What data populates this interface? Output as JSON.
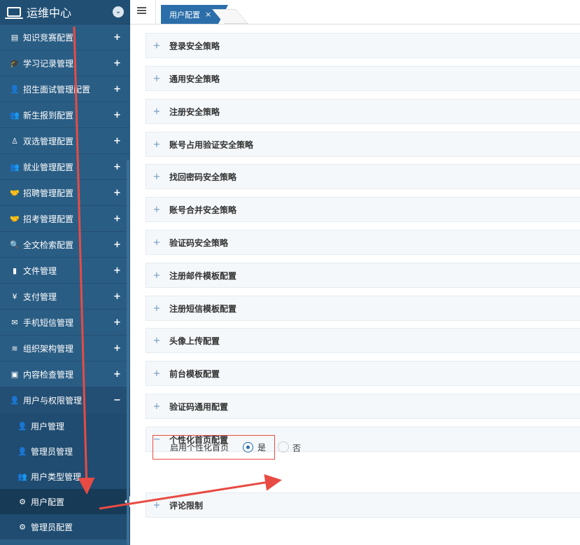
{
  "app": {
    "title": "运维中心"
  },
  "sidebar": {
    "items": [
      {
        "label": "知识竞赛配置",
        "icon": "document-icon",
        "glyph": "▤"
      },
      {
        "label": "学习记录管理",
        "icon": "graduation-cap-icon",
        "glyph": "🎓"
      },
      {
        "label": "招生面试管理配置",
        "icon": "user-plus-icon",
        "glyph": "👤"
      },
      {
        "label": "新生报到配置",
        "icon": "users-icon",
        "glyph": "👥"
      },
      {
        "label": "双选管理配置",
        "icon": "user-outline-icon",
        "glyph": "♙"
      },
      {
        "label": "就业管理配置",
        "icon": "user-group-icon",
        "glyph": "👥"
      },
      {
        "label": "招聘管理配置",
        "icon": "handshake-icon",
        "glyph": "🤝"
      },
      {
        "label": "招考管理配置",
        "icon": "handshake-icon",
        "glyph": "🤝"
      },
      {
        "label": "全文检索配置",
        "icon": "search-icon",
        "glyph": "🔍"
      },
      {
        "label": "文件管理",
        "icon": "file-icon",
        "glyph": "▮"
      },
      {
        "label": "支付管理",
        "icon": "yen-icon",
        "glyph": "¥"
      },
      {
        "label": "手机短信管理",
        "icon": "envelope-icon",
        "glyph": "✉"
      },
      {
        "label": "组织架构管理",
        "icon": "layers-icon",
        "glyph": "≋"
      },
      {
        "label": "内容检查管理",
        "icon": "image-icon",
        "glyph": "▣"
      }
    ],
    "open_group": {
      "label": "用户与权限管理",
      "icon": "user-icon",
      "glyph": "👤",
      "toggle": "−"
    },
    "sub_items": [
      {
        "label": "用户管理",
        "icon": "user-icon",
        "glyph": "👤"
      },
      {
        "label": "管理员管理",
        "icon": "user-icon",
        "glyph": "👤"
      },
      {
        "label": "用户类型管理",
        "icon": "users-icon",
        "glyph": "👥"
      },
      {
        "label": "用户配置",
        "icon": "gear-icon",
        "glyph": "⚙"
      },
      {
        "label": "管理员配置",
        "icon": "gear-icon",
        "glyph": "⚙"
      }
    ],
    "plus": "+"
  },
  "tabs": [
    {
      "label": "用户配置",
      "close": "×"
    }
  ],
  "panels": [
    {
      "label": "登录安全策略",
      "toggle": "+"
    },
    {
      "label": "通用安全策略",
      "toggle": "+"
    },
    {
      "label": "注册安全策略",
      "toggle": "+"
    },
    {
      "label": "账号占用验证安全策略",
      "toggle": "+"
    },
    {
      "label": "找回密码安全策略",
      "toggle": "+"
    },
    {
      "label": "账号合并安全策略",
      "toggle": "+"
    },
    {
      "label": "验证码安全策略",
      "toggle": "+"
    },
    {
      "label": "注册邮件模板配置",
      "toggle": "+"
    },
    {
      "label": "注册短信模板配置",
      "toggle": "+"
    },
    {
      "label": "头像上传配置",
      "toggle": "+"
    },
    {
      "label": "前台模板配置",
      "toggle": "+"
    },
    {
      "label": "验证码通用配置",
      "toggle": "+"
    },
    {
      "label": "个性化首页配置",
      "toggle": "−"
    },
    {
      "label": "评论限制",
      "toggle": "+"
    }
  ],
  "form": {
    "label": "启用个性化首页",
    "options": [
      {
        "label": "是",
        "selected": true
      },
      {
        "label": "否",
        "selected": false
      }
    ]
  },
  "colors": {
    "sidebar": "#2a5d84",
    "accent": "#2b6eaa",
    "annotation": "#e84b43"
  }
}
